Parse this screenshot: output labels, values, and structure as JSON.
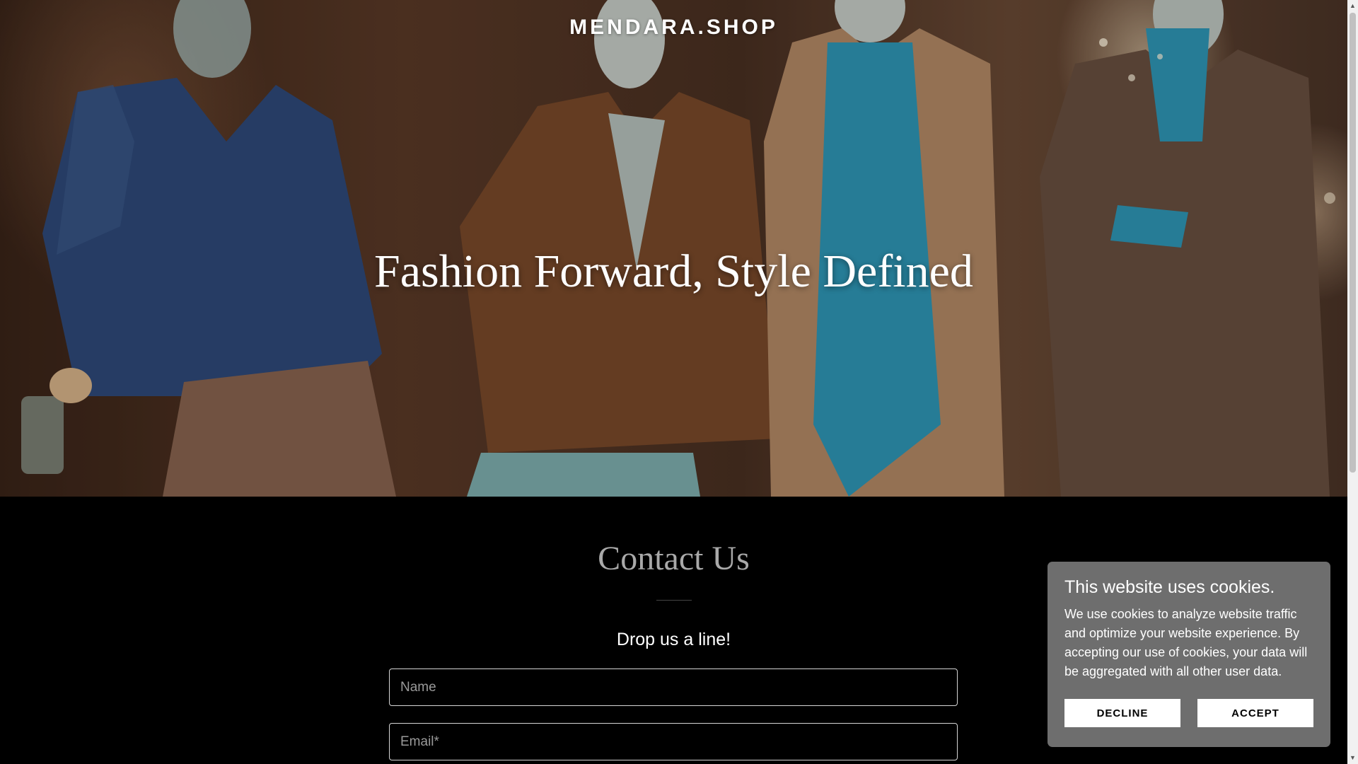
{
  "header": {
    "brand": "MENDARA.SHOP"
  },
  "hero": {
    "headline": "Fashion Forward, Style Defined"
  },
  "contact": {
    "title": "Contact Us",
    "subtitle": "Drop us a line!",
    "name_placeholder": "Name",
    "email_placeholder": "Email*"
  },
  "cookie_banner": {
    "title": "This website uses cookies.",
    "text": "We use cookies to analyze website traffic and optimize your website experience. By accepting our use of cookies, your data will be aggregated with all other user data.",
    "decline_label": "DECLINE",
    "accept_label": "ACCEPT"
  },
  "colors": {
    "page_background": "#000000",
    "cookie_background": "#6e6e6e",
    "contact_title": "#a9a9a9"
  }
}
